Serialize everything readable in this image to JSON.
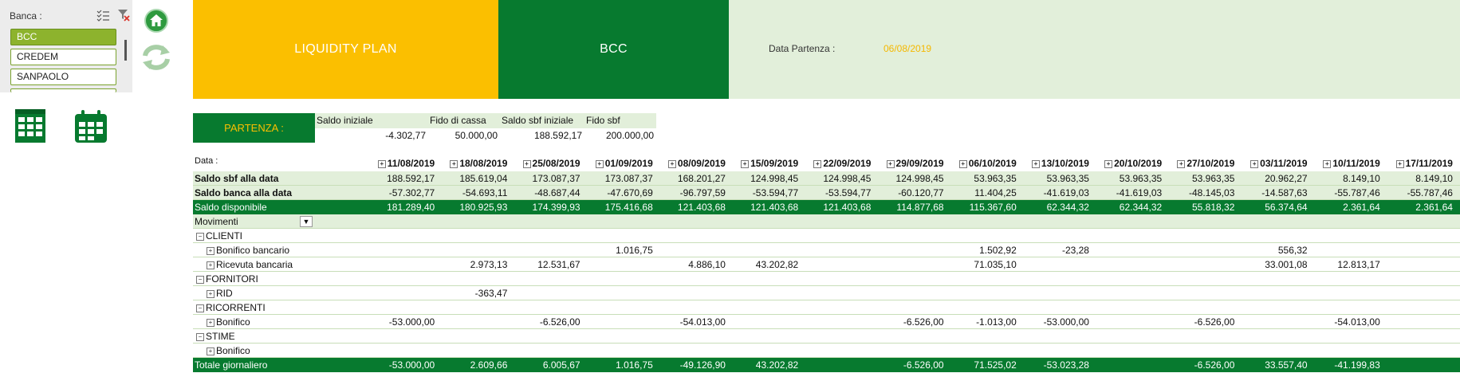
{
  "slicer": {
    "title": "Banca :",
    "items": [
      "BCC",
      "CREDEM",
      "SANPAOLO"
    ],
    "selected": "BCC"
  },
  "header": {
    "title": "LIQUIDITY PLAN",
    "bank": "BCC",
    "start_label": "Data Partenza :",
    "start_value": "06/08/2019"
  },
  "partenza": {
    "label": "PARTENZA :",
    "columns": [
      "Saldo iniziale",
      "Fido di cassa",
      "Saldo sbf iniziale",
      "Fido sbf"
    ],
    "values": [
      "-4.302,77",
      "50.000,00",
      "188.592,17",
      "200.000,00"
    ]
  },
  "pivot": {
    "data_label": "Data :",
    "dates": [
      "11/08/2019",
      "18/08/2019",
      "25/08/2019",
      "01/09/2019",
      "08/09/2019",
      "15/09/2019",
      "22/09/2019",
      "29/09/2019",
      "06/10/2019",
      "13/10/2019",
      "20/10/2019",
      "27/10/2019",
      "03/11/2019",
      "10/11/2019",
      "17/11/2019"
    ],
    "summary": [
      {
        "label": "Saldo sbf alla data",
        "values": [
          "188.592,17",
          "185.619,04",
          "173.087,37",
          "173.087,37",
          "168.201,27",
          "124.998,45",
          "124.998,45",
          "124.998,45",
          "53.963,35",
          "53.963,35",
          "53.963,35",
          "53.963,35",
          "20.962,27",
          "8.149,10",
          "8.149,10"
        ]
      },
      {
        "label": "Saldo banca alla data",
        "values": [
          "-57.302,77",
          "-54.693,11",
          "-48.687,44",
          "-47.670,69",
          "-96.797,59",
          "-53.594,77",
          "-53.594,77",
          "-60.120,77",
          "11.404,25",
          "-41.619,03",
          "-41.619,03",
          "-48.145,03",
          "-14.587,63",
          "-55.787,46",
          "-55.787,46"
        ]
      },
      {
        "label": "Saldo disponibile",
        "values": [
          "181.289,40",
          "180.925,93",
          "174.399,93",
          "175.416,68",
          "121.403,68",
          "121.403,68",
          "121.403,68",
          "114.877,68",
          "115.367,60",
          "62.344,32",
          "62.344,32",
          "55.818,32",
          "56.374,64",
          "2.361,64",
          "2.361,64"
        ]
      }
    ],
    "movimenti_label": "Movimenti",
    "rows": [
      {
        "label": "CLIENTI",
        "level": 0,
        "values": []
      },
      {
        "label": "Bonifico bancario",
        "level": 1,
        "values": [
          "",
          "",
          "",
          "1.016,75",
          "",
          "",
          "",
          "",
          "1.502,92",
          "-23,28",
          "",
          "",
          "556,32",
          "",
          ""
        ]
      },
      {
        "label": "Ricevuta bancaria",
        "level": 1,
        "values": [
          "",
          "2.973,13",
          "12.531,67",
          "",
          "4.886,10",
          "43.202,82",
          "",
          "",
          "71.035,10",
          "",
          "",
          "",
          "33.001,08",
          "12.813,17",
          ""
        ]
      },
      {
        "label": "FORNITORI",
        "level": 0,
        "values": []
      },
      {
        "label": "RID",
        "level": 1,
        "values": [
          "",
          "-363,47",
          "",
          "",
          "",
          "",
          "",
          "",
          "",
          "",
          "",
          "",
          "",
          "",
          ""
        ]
      },
      {
        "label": "RICORRENTI",
        "level": 0,
        "values": []
      },
      {
        "label": "Bonifico",
        "level": 1,
        "values": [
          "-53.000,00",
          "",
          "-6.526,00",
          "",
          "-54.013,00",
          "",
          "",
          "-6.526,00",
          "-1.013,00",
          "-53.000,00",
          "",
          "-6.526,00",
          "",
          "-54.013,00",
          ""
        ]
      },
      {
        "label": "STIME",
        "level": 0,
        "values": []
      },
      {
        "label": "Bonifico",
        "level": 1,
        "values": []
      }
    ],
    "total": {
      "label": "Totale giornaliero",
      "values": [
        "-53.000,00",
        "2.609,66",
        "6.005,67",
        "1.016,75",
        "-49.126,90",
        "43.202,82",
        "",
        "-6.526,00",
        "71.525,02",
        "-53.023,28",
        "",
        "-6.526,00",
        "33.557,40",
        "-41.199,83",
        ""
      ]
    }
  },
  "colors": {
    "yellow": "#fbbf00",
    "dark_green": "#077a2f",
    "light_green": "#e2efda",
    "lime": "#8db32d"
  }
}
